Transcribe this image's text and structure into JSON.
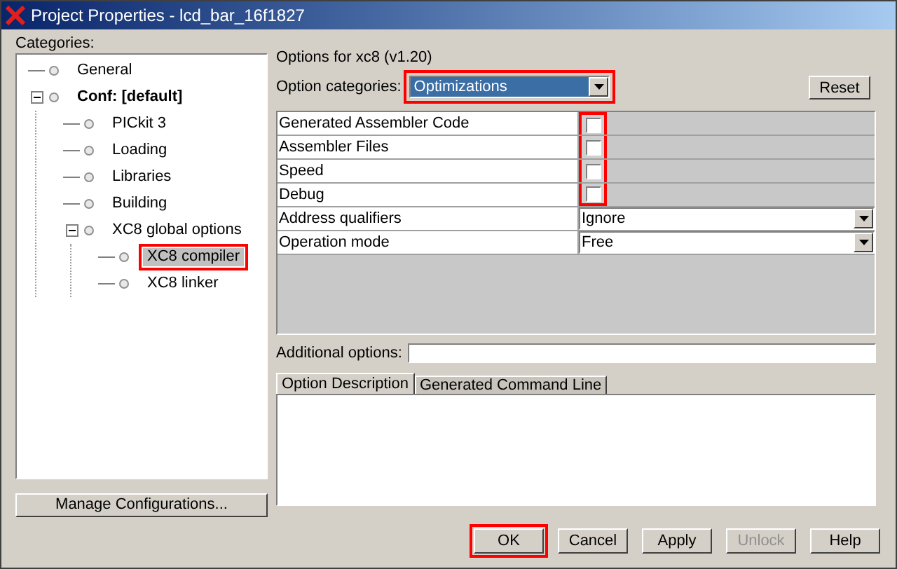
{
  "window": {
    "title": "Project Properties - lcd_bar_16f1827"
  },
  "categories": {
    "label": "Categories:",
    "tree": [
      {
        "label": "General",
        "bold": false,
        "selected": false,
        "highlighted": false
      },
      {
        "label": "Conf: [default]",
        "bold": true,
        "selected": false,
        "highlighted": false,
        "expanded": true,
        "children": [
          {
            "label": "PICkit 3",
            "bold": false,
            "selected": false,
            "highlighted": false
          },
          {
            "label": "Loading",
            "bold": false,
            "selected": false,
            "highlighted": false
          },
          {
            "label": "Libraries",
            "bold": false,
            "selected": false,
            "highlighted": false
          },
          {
            "label": "Building",
            "bold": false,
            "selected": false,
            "highlighted": false
          },
          {
            "label": "XC8 global options",
            "bold": false,
            "selected": false,
            "highlighted": false,
            "expanded": true,
            "children": [
              {
                "label": "XC8 compiler",
                "bold": false,
                "selected": true,
                "highlighted": true
              },
              {
                "label": "XC8 linker",
                "bold": false,
                "selected": false,
                "highlighted": false
              }
            ]
          }
        ]
      }
    ],
    "manage_button": "Manage Configurations..."
  },
  "options": {
    "heading": "Options for xc8 (v1.20)",
    "category_label": "Option categories:",
    "category_value": "Optimizations",
    "category_highlighted": true,
    "reset_button": "Reset",
    "rows": [
      {
        "kind": "checkbox",
        "label": "Generated Assembler Code",
        "checked": false
      },
      {
        "kind": "checkbox",
        "label": "Assembler Files",
        "checked": false
      },
      {
        "kind": "checkbox",
        "label": "Speed",
        "checked": false
      },
      {
        "kind": "checkbox",
        "label": "Debug",
        "checked": false
      },
      {
        "kind": "select",
        "label": "Address qualifiers",
        "value": "Ignore"
      },
      {
        "kind": "select",
        "label": "Operation mode",
        "value": "Free"
      }
    ],
    "checkboxes_highlighted": true,
    "additional_label": "Additional options:",
    "tabs": [
      {
        "label": "Option Description",
        "selected": true
      },
      {
        "label": "Generated Command Line",
        "selected": false
      }
    ]
  },
  "buttons": [
    {
      "label": "OK",
      "disabled": false,
      "highlighted": true
    },
    {
      "label": "Cancel",
      "disabled": false,
      "highlighted": false
    },
    {
      "label": "Apply",
      "disabled": false,
      "highlighted": false
    },
    {
      "label": "Unlock",
      "disabled": true,
      "highlighted": false
    },
    {
      "label": "Help",
      "disabled": false,
      "highlighted": false
    }
  ]
}
